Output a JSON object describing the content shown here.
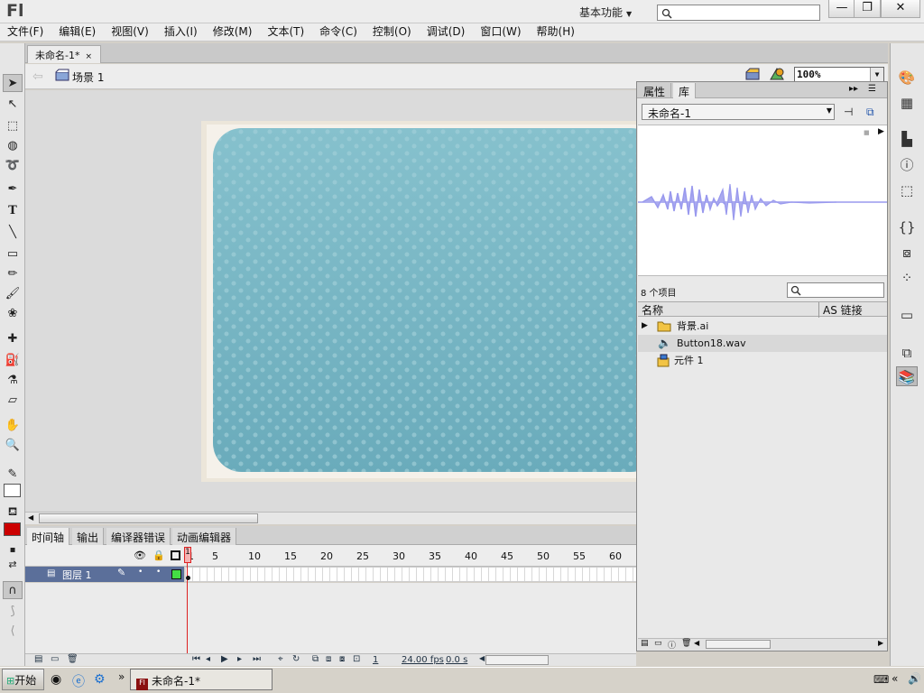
{
  "app": {
    "logo": "Fl",
    "workspace": "基本功能",
    "minimize": "—",
    "restore": "❐",
    "close": "✕"
  },
  "menu": [
    "文件(F)",
    "编辑(E)",
    "视图(V)",
    "插入(I)",
    "修改(M)",
    "文本(T)",
    "命令(C)",
    "控制(O)",
    "调试(D)",
    "窗口(W)",
    "帮助(H)"
  ],
  "doc": {
    "tab_title": "未命名-1*",
    "close": "×",
    "scene": "场景 1",
    "zoom": "100%"
  },
  "timeline": {
    "tabs": [
      "时间轴",
      "输出",
      "编译器错误",
      "动画编辑器"
    ],
    "frame_numbers": [
      "1",
      "5",
      "10",
      "15",
      "20",
      "25",
      "30",
      "35",
      "40",
      "45",
      "50",
      "55",
      "60"
    ],
    "layer_name": "图层 1",
    "current_frame": "1",
    "fps": "24.00 fps",
    "time": "0.0 s"
  },
  "library": {
    "tabs": [
      "属性",
      "库"
    ],
    "doc_select": "未命名-1",
    "item_count": "8 个项目",
    "col_name": "名称",
    "col_linkage": "AS 链接",
    "items": [
      {
        "name": "背景.ai",
        "icon": "folder-icon"
      },
      {
        "name": "Button18.wav",
        "icon": "sound-icon"
      },
      {
        "name": "元件 1",
        "icon": "movieclip-icon"
      }
    ]
  },
  "taskbar": {
    "start": "开始",
    "task": "未命名-1*",
    "more": "»"
  },
  "colors": {
    "stage_blue": "#7bb8c6",
    "stroke_color": "#222222",
    "fill_color": "#cc0000",
    "layer_highlight": "#5b6f9a",
    "wave_color": "#9999ee"
  }
}
